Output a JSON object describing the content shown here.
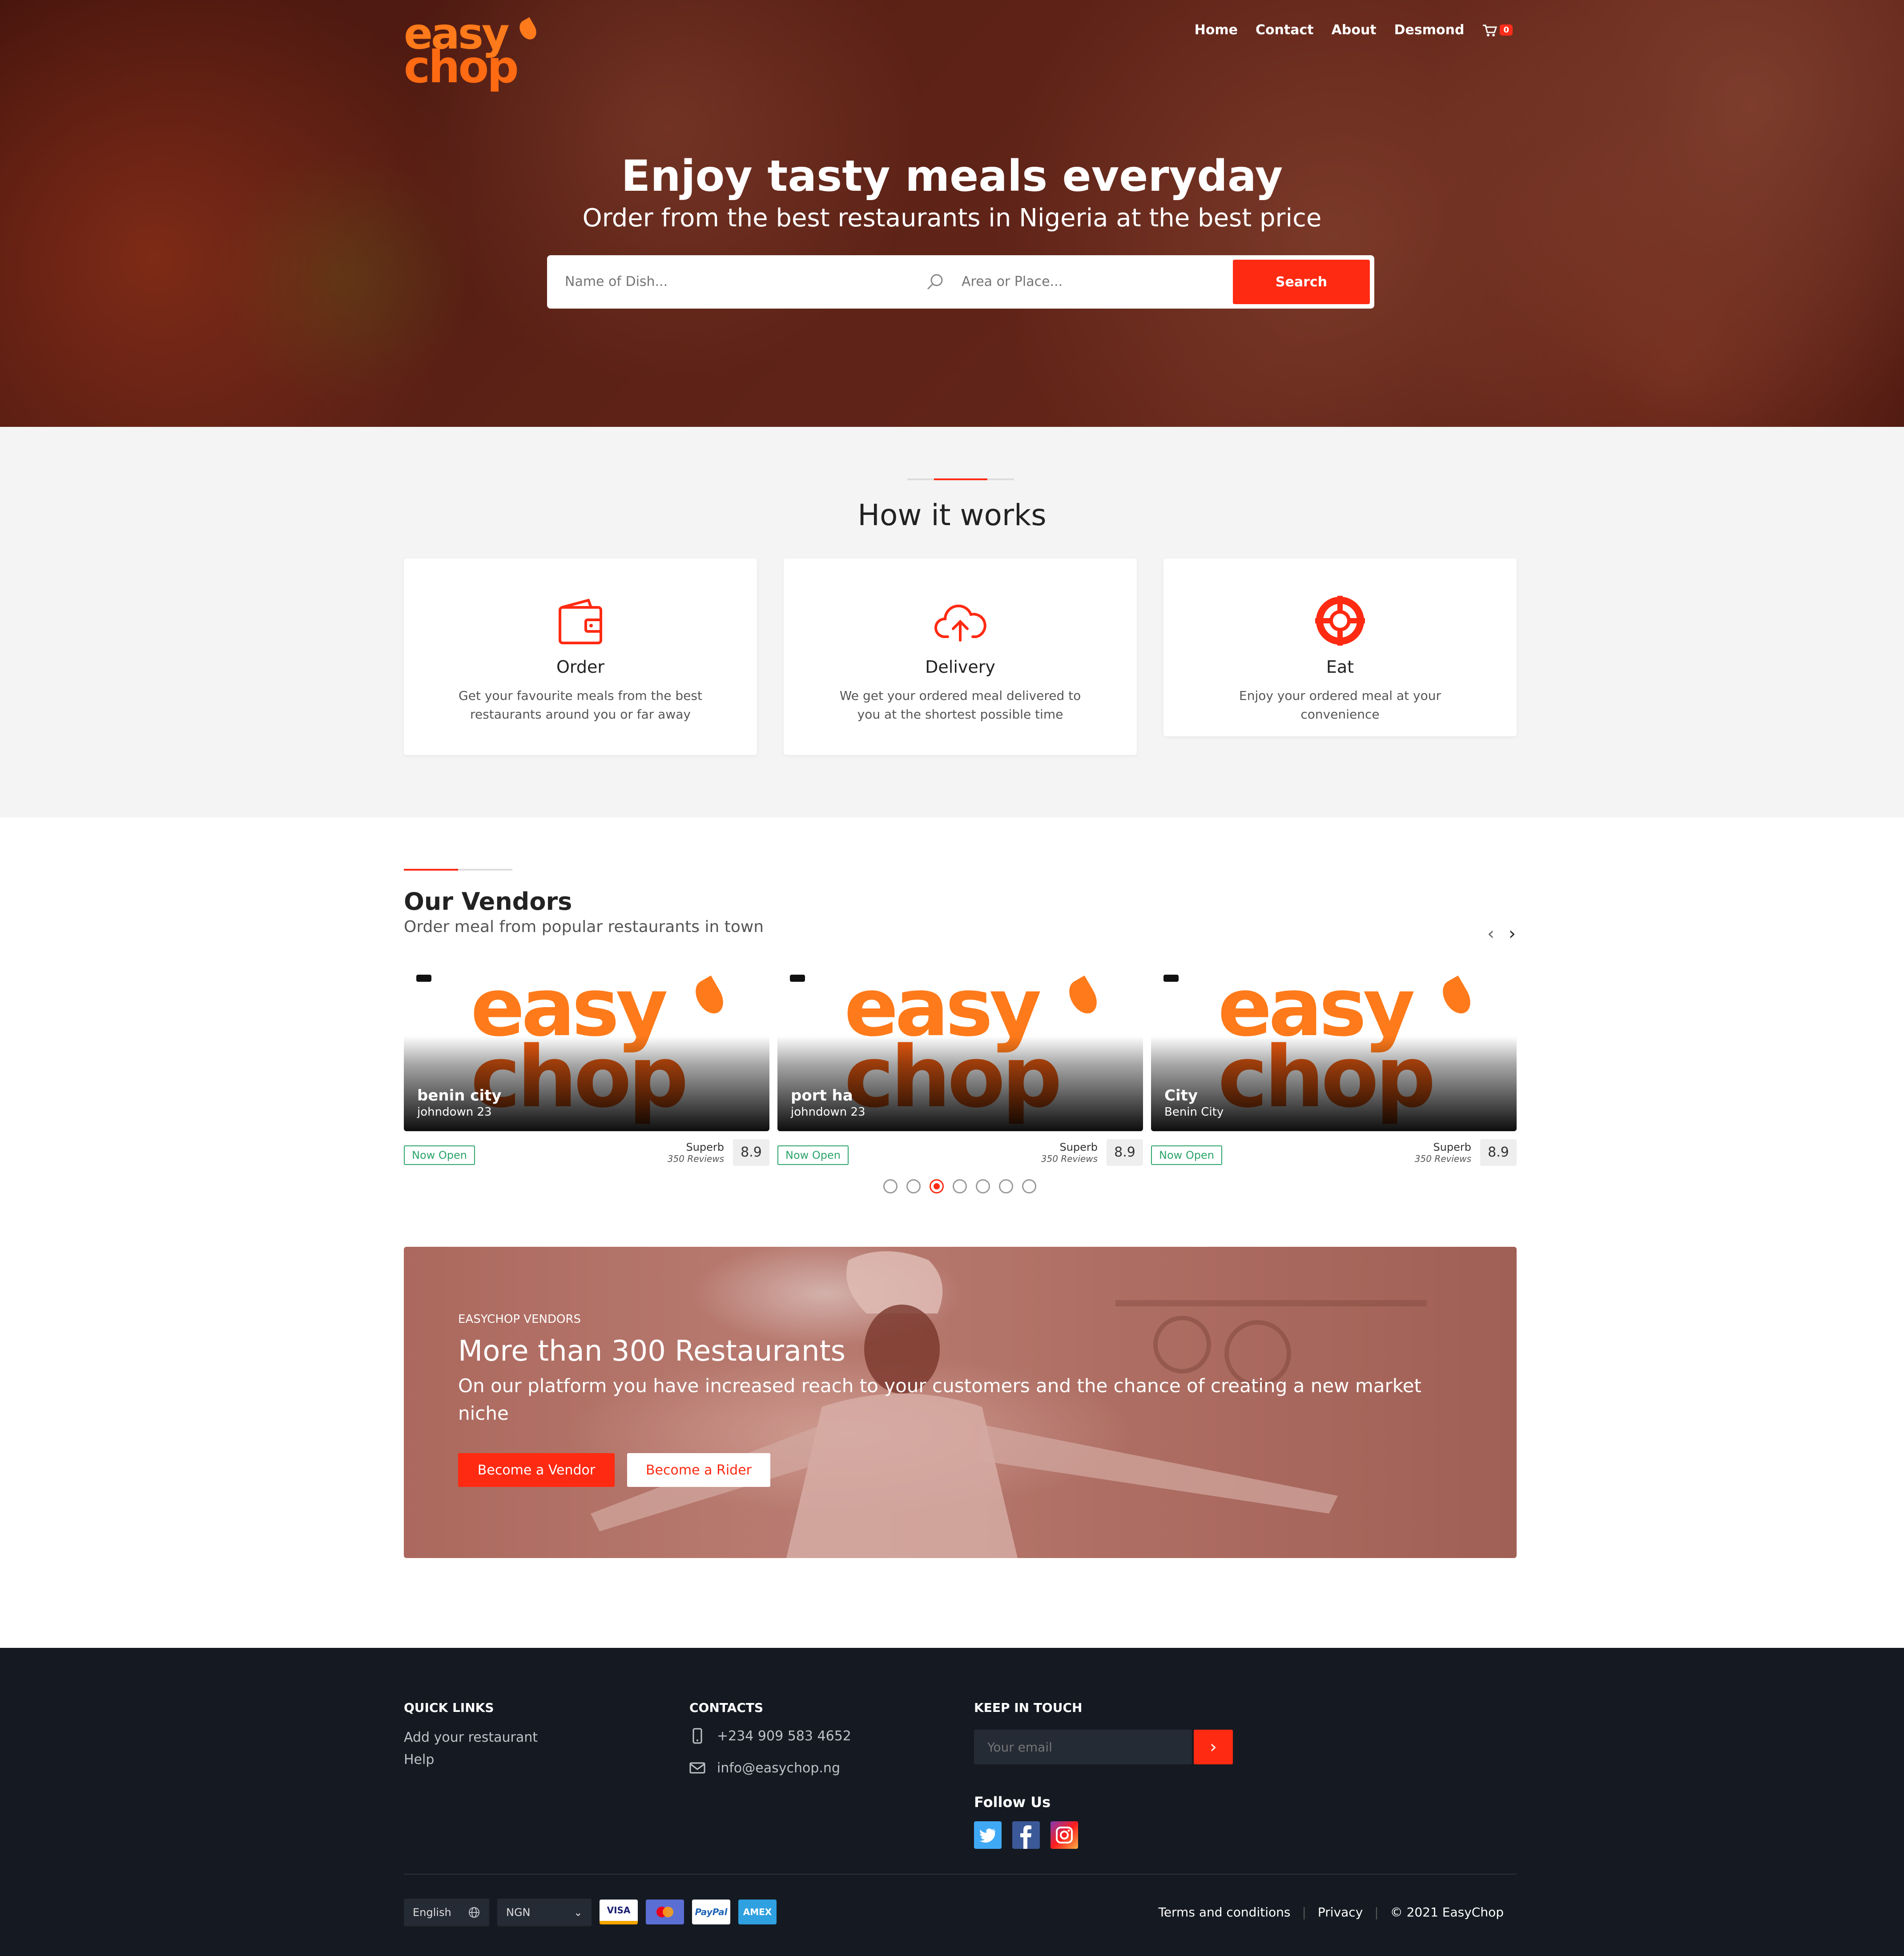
{
  "header": {
    "logo": {
      "line1": "easy",
      "line2": "chop"
    },
    "nav": [
      "Home",
      "Contact",
      "About",
      "Desmond"
    ],
    "cart_count": "0"
  },
  "hero": {
    "title": "Enjoy tasty meals everyday",
    "subtitle": "Order from the best restaurants in Nigeria at the best price",
    "dish_placeholder": "Name of Dish...",
    "area_placeholder": "Area or Place...",
    "search_label": "Search"
  },
  "how": {
    "title": "How it works",
    "cards": [
      {
        "title": "Order",
        "text": "Get your favourite meals from the best restaurants around you or far away",
        "icon": "wallet-icon"
      },
      {
        "title": "Delivery",
        "text": "We get your ordered meal delivered to you at the shortest possible time",
        "icon": "cloud-upload-icon"
      },
      {
        "title": "Eat",
        "text": "Enjoy your ordered meal at your convenience",
        "icon": "lifebuoy-icon"
      }
    ]
  },
  "vendors": {
    "title": "Our Vendors",
    "subtitle": "Order meal from popular restaurants in town",
    "items": [
      {
        "name": "benin city",
        "address": "johndown 23",
        "status": "Now Open",
        "rating_label": "Superb",
        "reviews": "350 Reviews",
        "score": "8.9"
      },
      {
        "name": "port ha",
        "address": "johndown 23",
        "status": "Now Open",
        "rating_label": "Superb",
        "reviews": "350 Reviews",
        "score": "8.9"
      },
      {
        "name": "City",
        "address": "Benin City",
        "status": "Now Open",
        "rating_label": "Superb",
        "reviews": "350 Reviews",
        "score": "8.9"
      }
    ],
    "card_brand": {
      "line1": "easy",
      "line2": "chop"
    },
    "pagination": {
      "count": 7,
      "active": 3
    }
  },
  "banner": {
    "kicker": "EASYCHOP VENDORS",
    "title": "More than 300 Restaurants",
    "text": "On our platform you have increased reach to your customers and the chance of creating a new market niche",
    "vendor_btn": "Become a Vendor",
    "rider_btn": "Become a Rider"
  },
  "footer": {
    "quick_links_title": "QUICK LINKS",
    "quick_links": [
      "Add your restaurant",
      "Help"
    ],
    "contacts_title": "CONTACTS",
    "phone": "+234 909 583 4652",
    "email": "info@easychop.ng",
    "keep_title": "KEEP IN TOUCH",
    "email_placeholder": "Your email",
    "follow_title": "Follow Us",
    "language": "English",
    "currency": "NGN",
    "payment_cards": [
      "VISA",
      "MasterCard",
      "PayPal",
      "AMEX"
    ],
    "terms": "Terms and conditions",
    "privacy": "Privacy",
    "copyright": "© 2021 EasyChop"
  },
  "colors": {
    "accent": "#ff2a12",
    "brand": "#ff7a1a",
    "footer": "#151a22"
  }
}
